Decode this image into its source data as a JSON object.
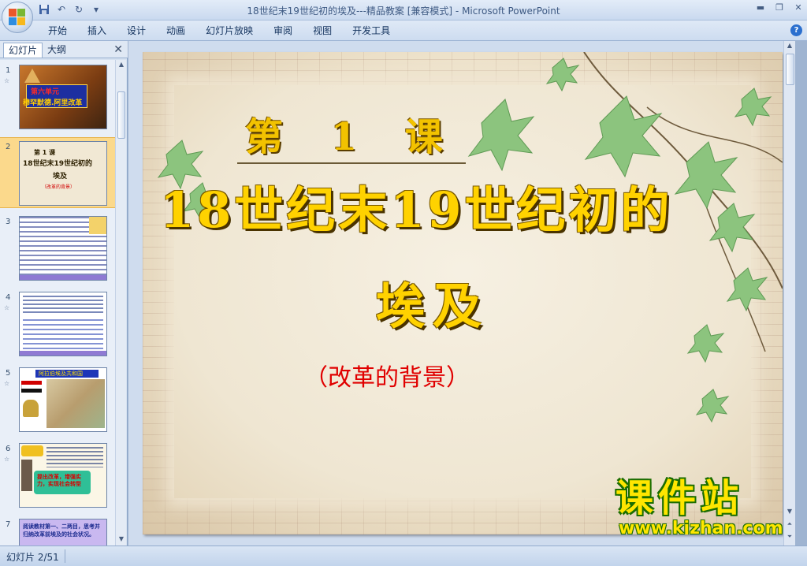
{
  "window": {
    "title": "18世纪末19世纪初的埃及---精品教案 [兼容模式] - Microsoft PowerPoint",
    "help_icon": "help-icon"
  },
  "ribbon": {
    "tabs": [
      "开始",
      "插入",
      "设计",
      "动画",
      "幻灯片放映",
      "审阅",
      "视图",
      "开发工具"
    ]
  },
  "left_pane": {
    "tabs": {
      "slides": "幻灯片",
      "outline": "大纲"
    },
    "thumbnails": [
      {
        "num": "1",
        "texts": [
          "第六单元",
          "穆罕默德.阿里改革"
        ]
      },
      {
        "num": "2",
        "texts": [
          "第 1 课",
          "18世纪末19世纪初的",
          "埃及",
          "（改革的背景）"
        ]
      },
      {
        "num": "3",
        "texts": []
      },
      {
        "num": "4",
        "texts": []
      },
      {
        "num": "5",
        "texts": [
          "阿拉伯埃及共和国"
        ]
      },
      {
        "num": "6",
        "texts": [
          "提出改革，增强实力，实现社会转型"
        ]
      },
      {
        "num": "7",
        "texts": [
          "阅读教材第一、二两目，思考并归纳改革前埃及的社会状况。"
        ]
      }
    ],
    "selected_index": 1
  },
  "slide": {
    "lesson": "第 1 课",
    "title_line1": "18世纪末19世纪初的",
    "title_line2": "埃及",
    "subtitle": "（改革的背景）",
    "watermark_top": "课件站",
    "watermark_bottom": "www.kjzhan.com"
  },
  "status": {
    "slide_indicator": "幻灯片 2/51"
  },
  "colors": {
    "title_fill": "#ffd200",
    "subtitle": "#e00000",
    "watermark_fill": "#ffe600",
    "watermark_outline": "#1b6d00",
    "selected_thumb": "#fbd98c"
  }
}
